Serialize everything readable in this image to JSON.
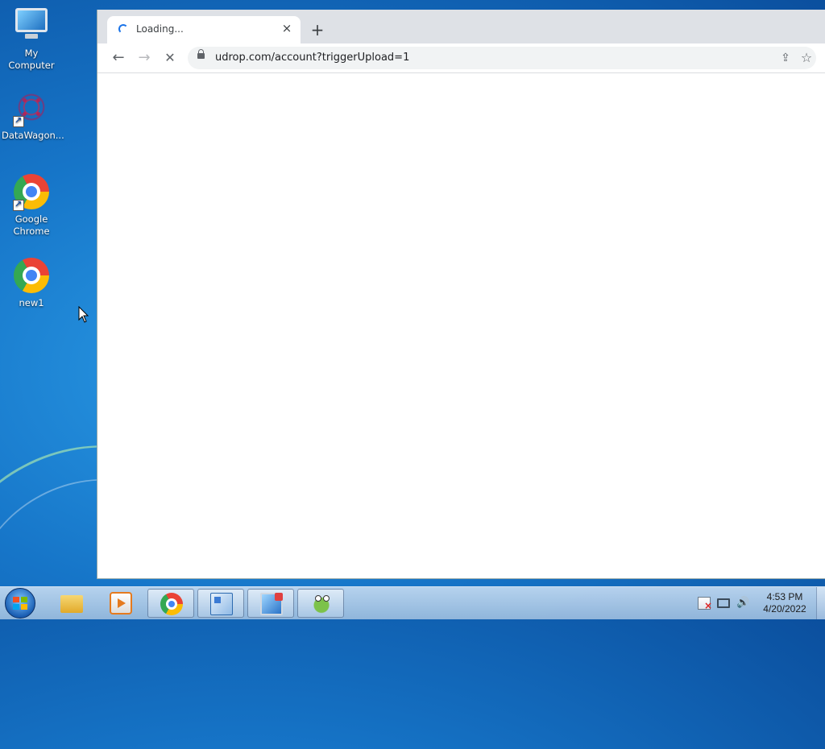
{
  "desktop": {
    "icons": [
      {
        "label": "My Computer"
      },
      {
        "label": "DataWagon..."
      },
      {
        "label": "Google Chrome"
      },
      {
        "label": "new1"
      }
    ]
  },
  "browser": {
    "tab": {
      "title": "Loading...",
      "close": "×"
    },
    "new_tab": "+",
    "toolbar": {
      "back": "←",
      "forward": "→",
      "stop": "✕",
      "url": "udrop.com/account?triggerUpload=1",
      "share": "⇪",
      "bookmark": "☆"
    }
  },
  "taskbar": {
    "apps": [
      "start-button",
      "file-explorer",
      "media-player",
      "google-chrome",
      "control-panel",
      "remote-desktop",
      "notepad-frog"
    ],
    "clock": {
      "time": "4:53 PM",
      "date": "4/20/2022"
    }
  },
  "colors": {
    "accent": "#1a73e8",
    "tabstrip": "#dee1e6",
    "omnibox": "#f1f3f4"
  }
}
